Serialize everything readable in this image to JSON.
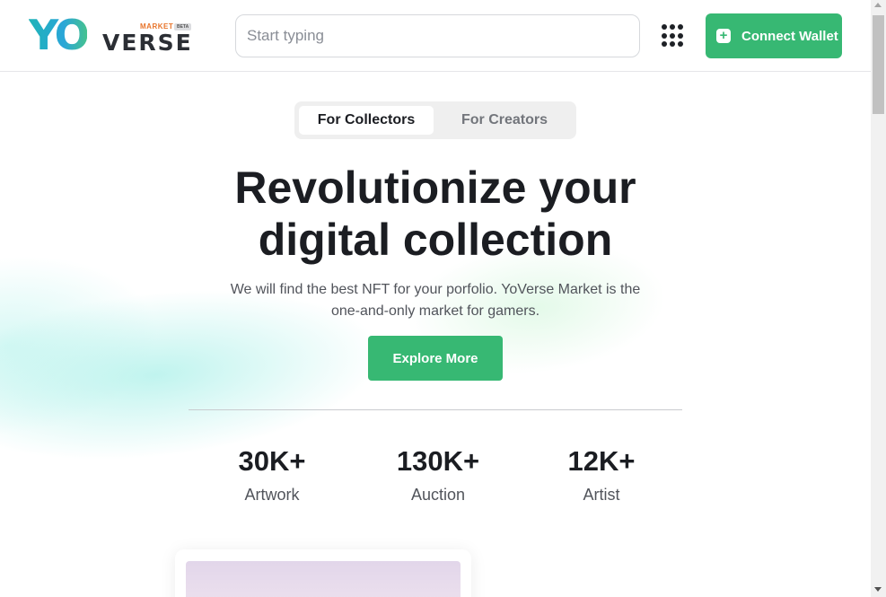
{
  "header": {
    "logo": {
      "main": "YO",
      "sub": "VERSE",
      "tag": "MARKET",
      "badge": "BETA"
    },
    "search": {
      "placeholder": "Start typing",
      "value": ""
    },
    "menu_icon": "grid-dots-icon",
    "connect_label": "Connect Wallet",
    "connect_icon": "plus-square-icon"
  },
  "hero": {
    "tabs": [
      {
        "label": "For Collectors",
        "active": true
      },
      {
        "label": "For Creators",
        "active": false
      }
    ],
    "title_line1": "Revolutionize your",
    "title_line2": "digital collection",
    "subtitle_line1": "We will find the best NFT for your porfolio. YoVerse Market is the",
    "subtitle_line2": "one-and-only market for gamers.",
    "cta_label": "Explore More"
  },
  "stats": [
    {
      "value": "30K+",
      "label": "Artwork"
    },
    {
      "value": "130K+",
      "label": "Auction"
    },
    {
      "value": "12K+",
      "label": "Artist"
    }
  ],
  "colors": {
    "accent": "#37b873",
    "text": "#1b1d22",
    "muted": "#51545b"
  }
}
